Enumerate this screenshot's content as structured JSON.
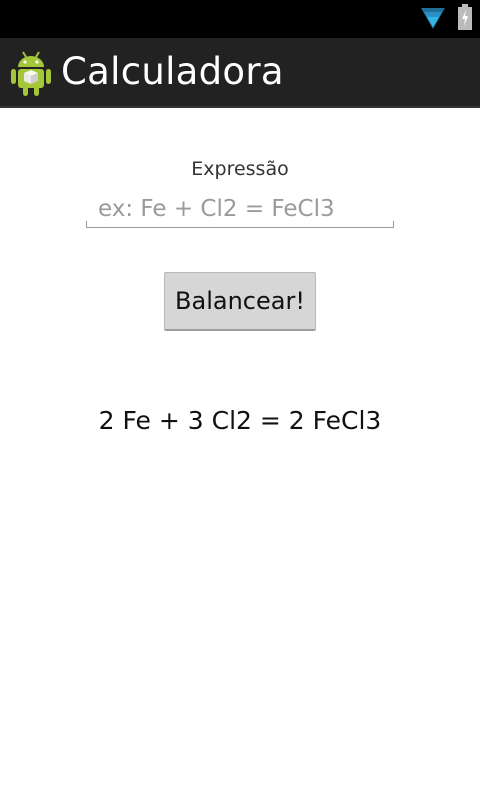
{
  "status_bar": {
    "icons": [
      "wifi-icon",
      "battery-charging-icon"
    ]
  },
  "action_bar": {
    "title": "Calculadora",
    "icon": "android-robot-icon"
  },
  "form": {
    "label": "Expressão",
    "input_value": "",
    "input_placeholder": "ex: Fe + Cl2 = FeCl3",
    "button_label": "Balancear!"
  },
  "result": {
    "text": "2 Fe + 3 Cl2 = 2 FeCl3"
  },
  "colors": {
    "status_bar": "#000000",
    "action_bar": "#222222",
    "wifi": "#33b5e5",
    "android_green": "#a4c639",
    "button": "#d6d6d6"
  }
}
